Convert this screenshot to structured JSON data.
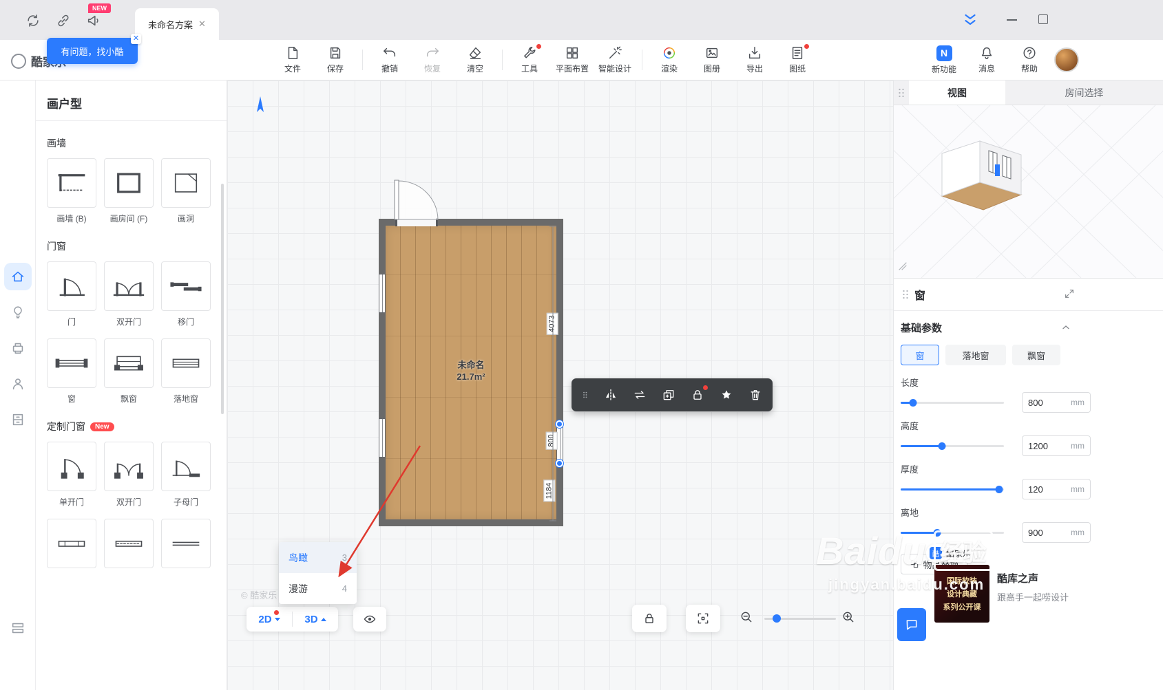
{
  "topbar": {
    "tab": {
      "title": "未命名方案"
    },
    "new_badge": "NEW",
    "tooltip": {
      "text": "有问题，找小酷"
    },
    "logo_text": "酷家乐"
  },
  "toolbar": {
    "items": [
      {
        "label": "文件"
      },
      {
        "label": "保存"
      },
      {
        "label": "撤销"
      },
      {
        "label": "恢复"
      },
      {
        "label": "清空"
      },
      {
        "label": "工具"
      },
      {
        "label": "平面布置"
      },
      {
        "label": "智能设计"
      },
      {
        "label": "渲染"
      },
      {
        "label": "图册"
      },
      {
        "label": "导出"
      },
      {
        "label": "图纸"
      }
    ],
    "right": [
      {
        "label": "新功能"
      },
      {
        "label": "消息"
      },
      {
        "label": "帮助"
      }
    ]
  },
  "left_panel": {
    "title": "画户型",
    "section_wall": "画墙",
    "wall_items": [
      "画墙 (B)",
      "画房间 (F)",
      "画洞"
    ],
    "section_door": "门窗",
    "door_items": [
      "门",
      "双开门",
      "移门",
      "窗",
      "飘窗",
      "落地窗"
    ],
    "section_custom": "定制门窗",
    "custom_badge": "New",
    "custom_items": [
      "单开门",
      "双开门",
      "子母门"
    ]
  },
  "canvas": {
    "room": {
      "name": "未命名",
      "area": "21.7m²"
    },
    "dims": {
      "wall": "4073",
      "window": "800",
      "offset": "1184"
    },
    "watermark": "© 酷家乐",
    "view_menu": [
      {
        "label": "鸟瞰",
        "key": "3"
      },
      {
        "label": "漫游",
        "key": "4"
      }
    ],
    "modes": {
      "d2": "2D",
      "d3": "3D"
    }
  },
  "right_top": {
    "tabs": [
      {
        "label": "视图"
      },
      {
        "label": "房间选择"
      }
    ]
  },
  "props": {
    "title": "窗",
    "section": "基础参数",
    "types": [
      {
        "label": "窗"
      },
      {
        "label": "落地窗"
      },
      {
        "label": "飘窗"
      }
    ],
    "params": [
      {
        "label": "长度",
        "value": "800",
        "unit": "mm",
        "pct": 12
      },
      {
        "label": "高度",
        "value": "1200",
        "unit": "mm",
        "pct": 40
      },
      {
        "label": "厚度",
        "value": "120",
        "unit": "mm",
        "pct": 95
      },
      {
        "label": "离地",
        "value": "900",
        "unit": "mm",
        "pct": 35
      }
    ],
    "extra_button": "物品替换"
  },
  "promo": {
    "brand": "酷家乐",
    "title": "酷库之声",
    "subtitle": "跟高手一起唠设计",
    "thumb": [
      "国际软装",
      "设计典藏",
      "系列公开课"
    ]
  },
  "watermark": {
    "brand": "Baidu",
    "seal": "经验",
    "url": "jingyan.baidu.com"
  },
  "icons": {
    "refresh": "sync-icon",
    "link": "link-icon",
    "megaphone": "announcement-icon",
    "lock": "lock-icon",
    "star": "favorite-icon",
    "trash": "delete-icon",
    "mirror": "mirror-icon",
    "swap": "swap-icon",
    "copy": "duplicate-icon",
    "eye": "visibility-icon",
    "focus": "fit-view-icon"
  },
  "colors": {
    "accent": "#2b7bfe",
    "wood": "#c89e6a",
    "wall": "#6a6a6a",
    "danger": "#f0413c"
  }
}
